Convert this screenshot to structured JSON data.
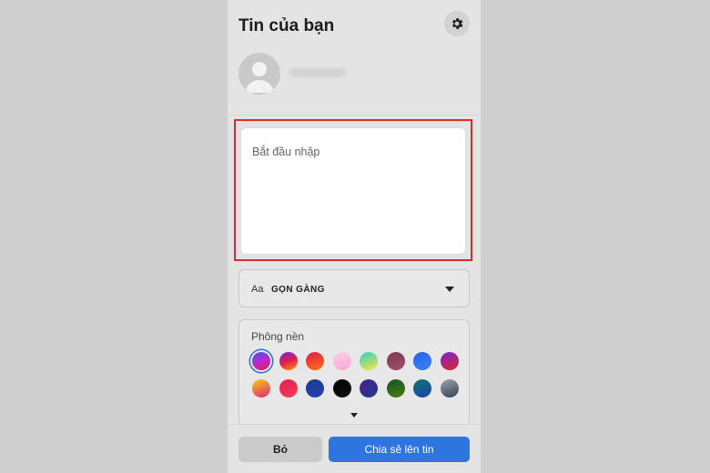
{
  "header": {
    "title": "Tin của bạn",
    "settings_icon": "gear-icon"
  },
  "profile": {
    "avatar_icon": "person-avatar-icon"
  },
  "composer": {
    "placeholder": "Bắt đầu nhập",
    "highlight_color": "#e0282e"
  },
  "font_selector": {
    "prefix": "Aa",
    "selected_font": "GỌN GÀNG"
  },
  "backgrounds": {
    "label": "Phông nền",
    "selected_index": 0,
    "swatches": [
      {
        "name": "purple-blue-red-gradient",
        "colors": [
          "#3b5bdb",
          "#c026d3",
          "#e11d48"
        ]
      },
      {
        "name": "purple-red-orange-gradient",
        "colors": [
          "#6d28d9",
          "#e11d48",
          "#f59e0b"
        ]
      },
      {
        "name": "red-orange-gradient",
        "colors": [
          "#e11d48",
          "#f97316"
        ]
      },
      {
        "name": "pink-white-gradient",
        "colors": [
          "#fbcfe8",
          "#f9a8d4"
        ]
      },
      {
        "name": "teal-yellow-gradient",
        "colors": [
          "#2dd4bf",
          "#fde047"
        ]
      },
      {
        "name": "mauve-solid",
        "colors": [
          "#7c3a50",
          "#a05070"
        ]
      },
      {
        "name": "blue-solid",
        "colors": [
          "#2563eb",
          "#3b82f6"
        ]
      },
      {
        "name": "purple-red-gradient",
        "colors": [
          "#7e22ce",
          "#dc2626"
        ]
      },
      {
        "name": "yellow-pink-gradient",
        "colors": [
          "#facc15",
          "#db2777"
        ]
      },
      {
        "name": "red-pink-solid",
        "colors": [
          "#e11d48",
          "#f43f5e"
        ]
      },
      {
        "name": "navy-blue-solid",
        "colors": [
          "#1e3a8a",
          "#2541b2"
        ]
      },
      {
        "name": "black-solid",
        "colors": [
          "#000000",
          "#111111"
        ]
      },
      {
        "name": "purple-blue-dark",
        "colors": [
          "#4c1d95",
          "#1e3a8a"
        ]
      },
      {
        "name": "green-leaves",
        "colors": [
          "#14532d",
          "#4d7c0f"
        ]
      },
      {
        "name": "teal-water",
        "colors": [
          "#0f766e",
          "#1e40af"
        ]
      },
      {
        "name": "gray-dark",
        "colors": [
          "#9ca3af",
          "#374151"
        ]
      }
    ]
  },
  "actions": {
    "cancel_label": "Bỏ",
    "share_label": "Chia sẻ lên tin",
    "share_color": "#2f75e0"
  }
}
